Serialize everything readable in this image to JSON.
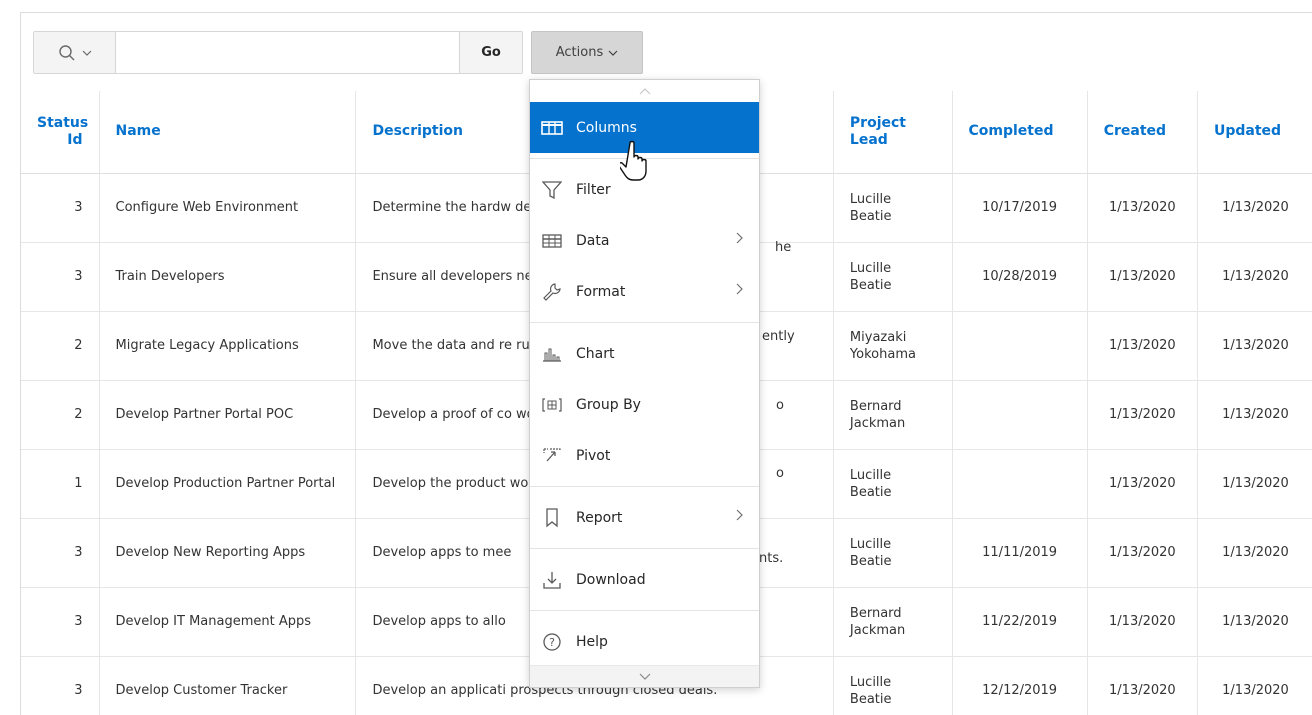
{
  "toolbar": {
    "search_placeholder": "",
    "go_label": "Go",
    "actions_label": "Actions"
  },
  "columns": [
    "Status Id",
    "Name",
    "Description",
    "Project Lead",
    "Completed",
    "Created",
    "Updated"
  ],
  "rows": [
    {
      "status_id": "3",
      "name": "Configure Web Environment",
      "description": "Determine the hardw develop with Web de",
      "project_lead": "Lucille Beatie",
      "completed": "10/17/2019",
      "created": "1/13/2020",
      "updated": "1/13/2020"
    },
    {
      "status_id": "3",
      "name": "Train Developers",
      "description": "Ensure all developers new tool get the app",
      "project_lead": "Lucille Beatie",
      "completed": "10/28/2019",
      "created": "1/13/2020",
      "updated": "1/13/2020"
    },
    {
      "status_id": "2",
      "name": "Migrate Legacy Applications",
      "description": "Move the data and re running on top of leg",
      "project_lead": "Miyazaki Yokohama",
      "completed": "",
      "created": "1/13/2020",
      "updated": "1/13/2020"
    },
    {
      "status_id": "2",
      "name": "Develop Partner Portal POC",
      "description": "Develop a proof of co work more collaborat",
      "project_lead": "Bernard Jackman",
      "completed": "",
      "created": "1/13/2020",
      "updated": "1/13/2020"
    },
    {
      "status_id": "1",
      "name": "Develop Production Partner Portal",
      "description": "Develop the product work more collaborat",
      "project_lead": "Lucille Beatie",
      "completed": "",
      "created": "1/13/2020",
      "updated": "1/13/2020"
    },
    {
      "status_id": "3",
      "name": "Develop New Reporting Apps",
      "description": "Develop apps to mee",
      "project_lead": "Lucille Beatie",
      "completed": "11/11/2019",
      "created": "1/13/2020",
      "updated": "1/13/2020"
    },
    {
      "status_id": "3",
      "name": "Develop IT Management Apps",
      "description": "Develop apps to allo",
      "project_lead": "Bernard Jackman",
      "completed": "11/22/2019",
      "created": "1/13/2020",
      "updated": "1/13/2020"
    },
    {
      "status_id": "3",
      "name": "Develop Customer Tracker",
      "description": "Develop an applicati prospects through closed deals.",
      "project_lead": "Lucille Beatie",
      "completed": "12/12/2019",
      "created": "1/13/2020",
      "updated": "1/13/2020"
    }
  ],
  "hidden_fragments": [
    "he",
    "ently",
    "o",
    "o",
    "nts."
  ],
  "menu": {
    "items": [
      {
        "label": "Columns",
        "icon": "columns-icon",
        "active": true,
        "submenu": false
      },
      {
        "label": "Filter",
        "icon": "filter-icon",
        "active": false,
        "submenu": false
      },
      {
        "label": "Data",
        "icon": "table-icon",
        "active": false,
        "submenu": true
      },
      {
        "label": "Format",
        "icon": "wrench-icon",
        "active": false,
        "submenu": true
      },
      {
        "label": "Chart",
        "icon": "chart-icon",
        "active": false,
        "submenu": false
      },
      {
        "label": "Group By",
        "icon": "group-by-icon",
        "active": false,
        "submenu": false
      },
      {
        "label": "Pivot",
        "icon": "pivot-icon",
        "active": false,
        "submenu": false
      },
      {
        "label": "Report",
        "icon": "bookmark-icon",
        "active": false,
        "submenu": true
      },
      {
        "label": "Download",
        "icon": "download-icon",
        "active": false,
        "submenu": false
      },
      {
        "label": "Help",
        "icon": "help-icon",
        "active": false,
        "submenu": false
      }
    ]
  },
  "colors": {
    "accent": "#0572ce",
    "header_text": "#0572ce",
    "actions_button": "#d6d6d6"
  }
}
